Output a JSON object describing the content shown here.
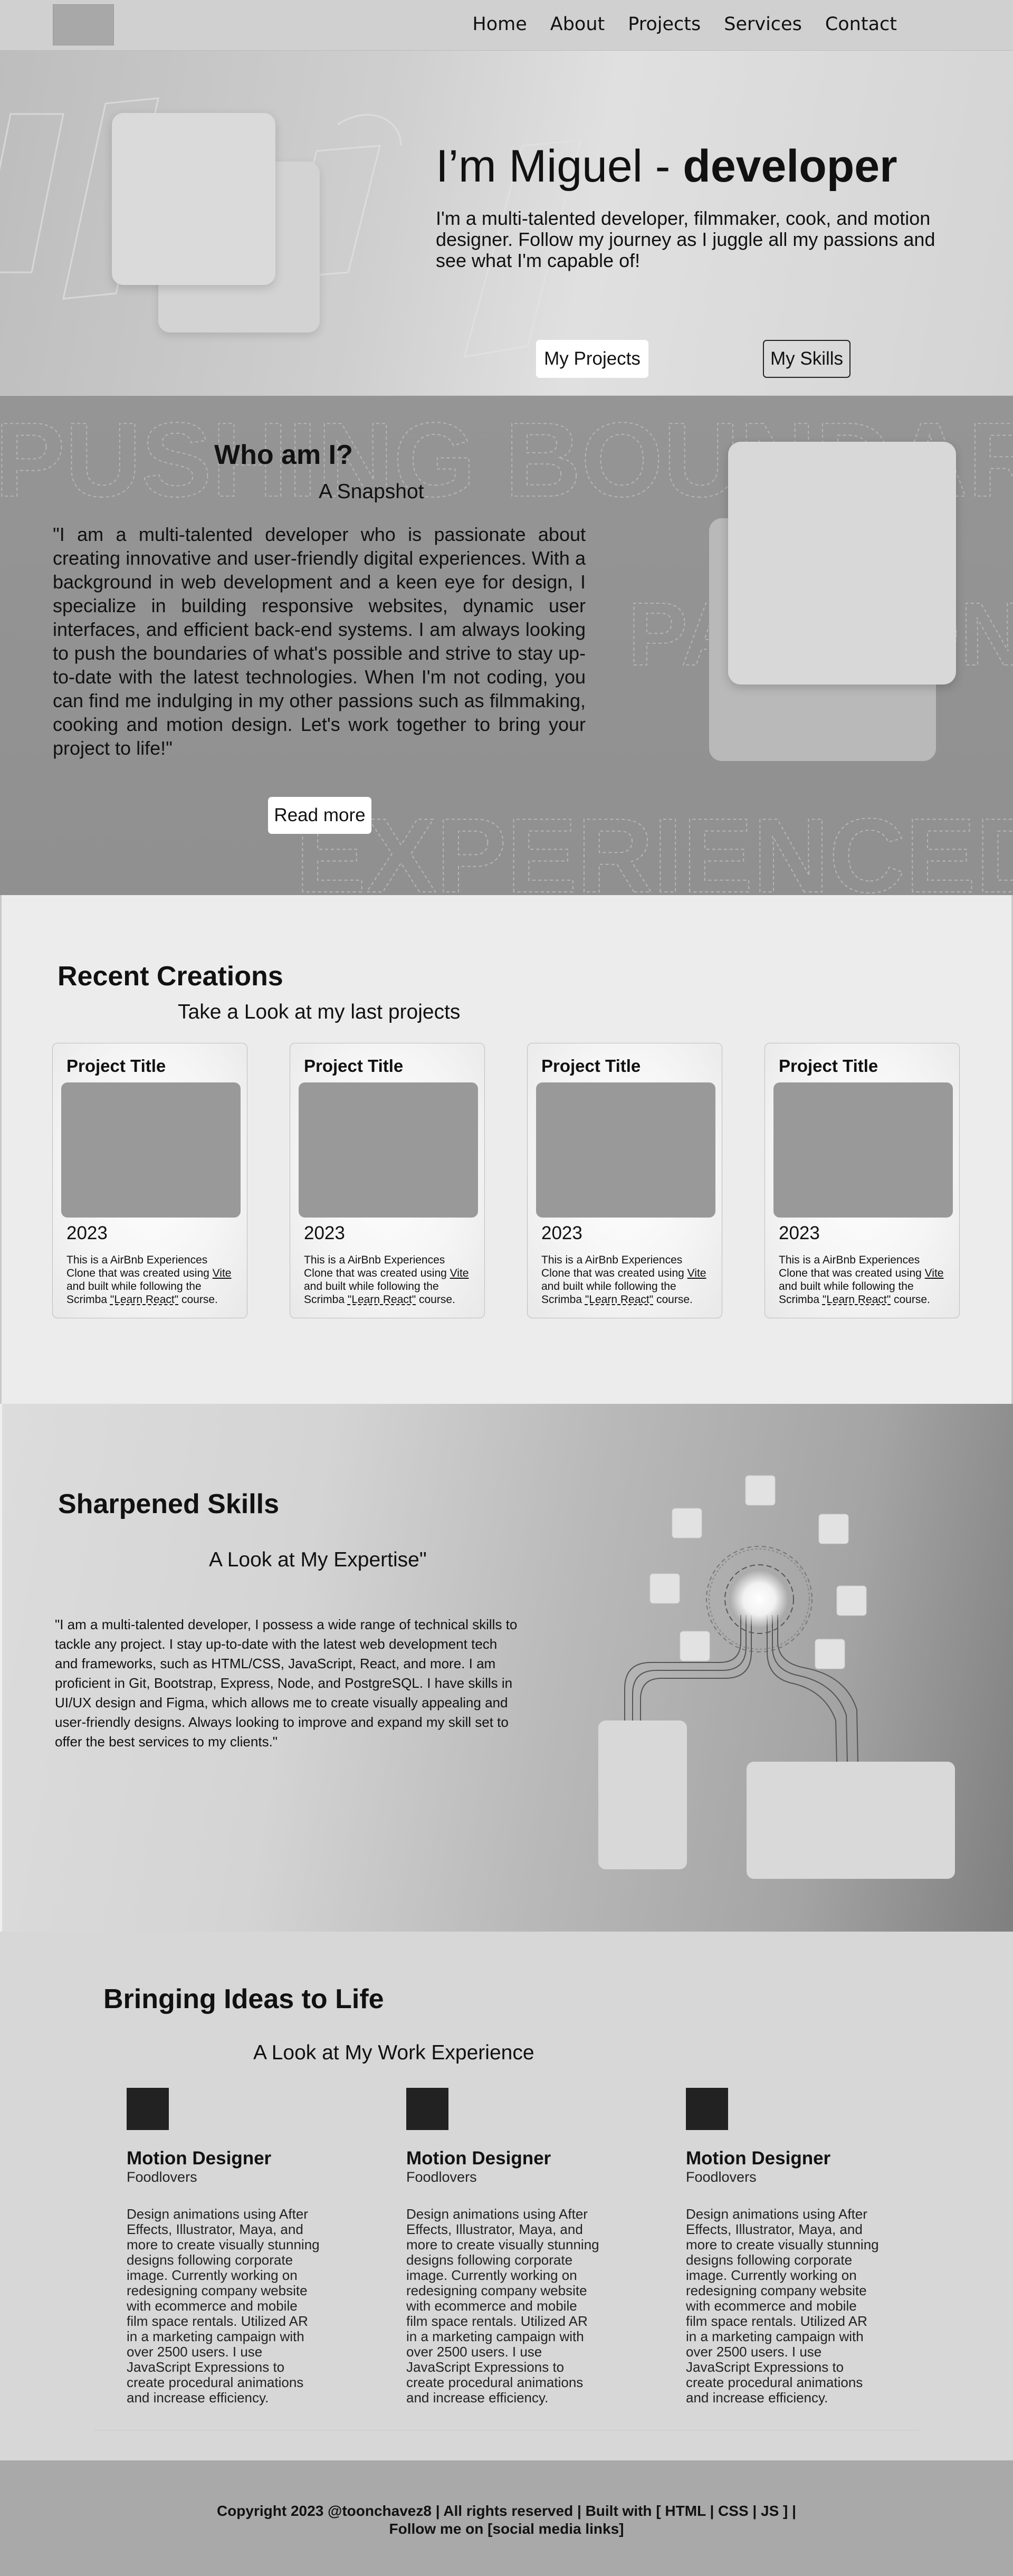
{
  "nav": {
    "items": [
      "Home",
      "About",
      "Projects",
      "Services",
      "Contact"
    ]
  },
  "hero": {
    "title_light": "I’m Miguel - ",
    "title_bold": "developer",
    "intro": "I'm a multi-talented developer, filmmaker, cook, and motion designer. Follow my journey as I juggle all my passions and see what I'm capable of!",
    "btn_projects": "My Projects",
    "btn_skills": "My Skills"
  },
  "about": {
    "title": "Who am I?",
    "subtitle": "A Snapshot",
    "quote": "\"I am a multi-talented developer who is passionate about creating innovative and user-friendly digital experiences. With a background in web development and a keen eye for design, I specialize in building responsive websites, dynamic user interfaces, and efficient back-end systems. I am always looking to push the boundaries of what's possible and strive to stay up-to-date with the latest technologies. When I'm not coding, you can find me indulging in my other passions such as filmmaking, cooking and motion design. Let's work together to bring your project to life!\"",
    "btn_read": "Read more",
    "bg_words": [
      "PUSHING BOUNDARIES",
      "PASSIONATE",
      "EXPERIENCED"
    ]
  },
  "projects": {
    "title": "Recent Creations",
    "subtitle": "Take a Look at my last projects",
    "cards": [
      {
        "title": "Project Title",
        "year": "2023",
        "desc_a": "This is a AirBnb Experiences Clone that was created using ",
        "vite": "Vite",
        "desc_b": " and built while following the Scrimba ",
        "learn": "\"Learn React\"",
        "desc_c": " course."
      },
      {
        "title": "Project Title",
        "year": "2023",
        "desc_a": "This is a AirBnb Experiences Clone that was created using ",
        "vite": "Vite",
        "desc_b": " and built while following the Scrimba ",
        "learn": "\"Learn React\"",
        "desc_c": " course."
      },
      {
        "title": "Project Title",
        "year": "2023",
        "desc_a": "This is a AirBnb Experiences Clone that was created using ",
        "vite": "Vite",
        "desc_b": " and built while following the Scrimba ",
        "learn": "\"Learn React\"",
        "desc_c": " course."
      },
      {
        "title": "Project Title",
        "year": "2023",
        "desc_a": "This is a AirBnb Experiences Clone that was created using ",
        "vite": "Vite",
        "desc_b": " and built while following the Scrimba ",
        "learn": "\"Learn React\"",
        "desc_c": " course."
      }
    ]
  },
  "skills": {
    "title": "Sharpened Skills",
    "subtitle": "A Look at My Expertise\"",
    "quote": "\"I am a multi-talented developer, I possess a wide range of technical skills to tackle any project. I stay up-to-date with the latest web development tech and frameworks, such as HTML/CSS, JavaScript, React, and more. I am proficient in Git, Bootstrap, Express, Node, and PostgreSQL. I have skills in UI/UX design and Figma, which allows me to create visually appealing and user-friendly designs. Always looking to improve and expand my skill set to offer the best services to my clients.\""
  },
  "experience": {
    "title": "Bringing Ideas to Life",
    "subtitle": "A Look at My Work Experience",
    "jobs": [
      {
        "role": "Motion Designer",
        "company": "Foodlovers",
        "desc": "Design animations using After Effects, Illustrator, Maya, and more to create visually stunning designs following corporate image. Currently working on redesigning company website with ecommerce and mobile film space rentals. Utilized AR in a marketing campaign with over 2500 users. I use JavaScript Expressions to create procedural animations and increase efficiency."
      },
      {
        "role": "Motion Designer",
        "company": "Foodlovers",
        "desc": "Design animations using After Effects, Illustrator, Maya, and more to create visually stunning designs following corporate image. Currently working on redesigning company website with ecommerce and mobile film space rentals. Utilized AR in a marketing campaign with over 2500 users. I use JavaScript Expressions to create procedural animations and increase efficiency."
      },
      {
        "role": "Motion Designer",
        "company": "Foodlovers",
        "desc": "Design animations using After Effects, Illustrator, Maya, and more to create visually stunning designs following corporate image. Currently working on redesigning company website with ecommerce and mobile film space rentals. Utilized AR in a marketing campaign with over 2500 users. I use JavaScript Expressions to create procedural animations and increase efficiency."
      }
    ]
  },
  "footer": {
    "line1": "Copyright 2023 @toonchavez8 | All rights reserved | Built with [ HTML | CSS | JS ] |",
    "line2": "Follow me on [social media links]"
  }
}
